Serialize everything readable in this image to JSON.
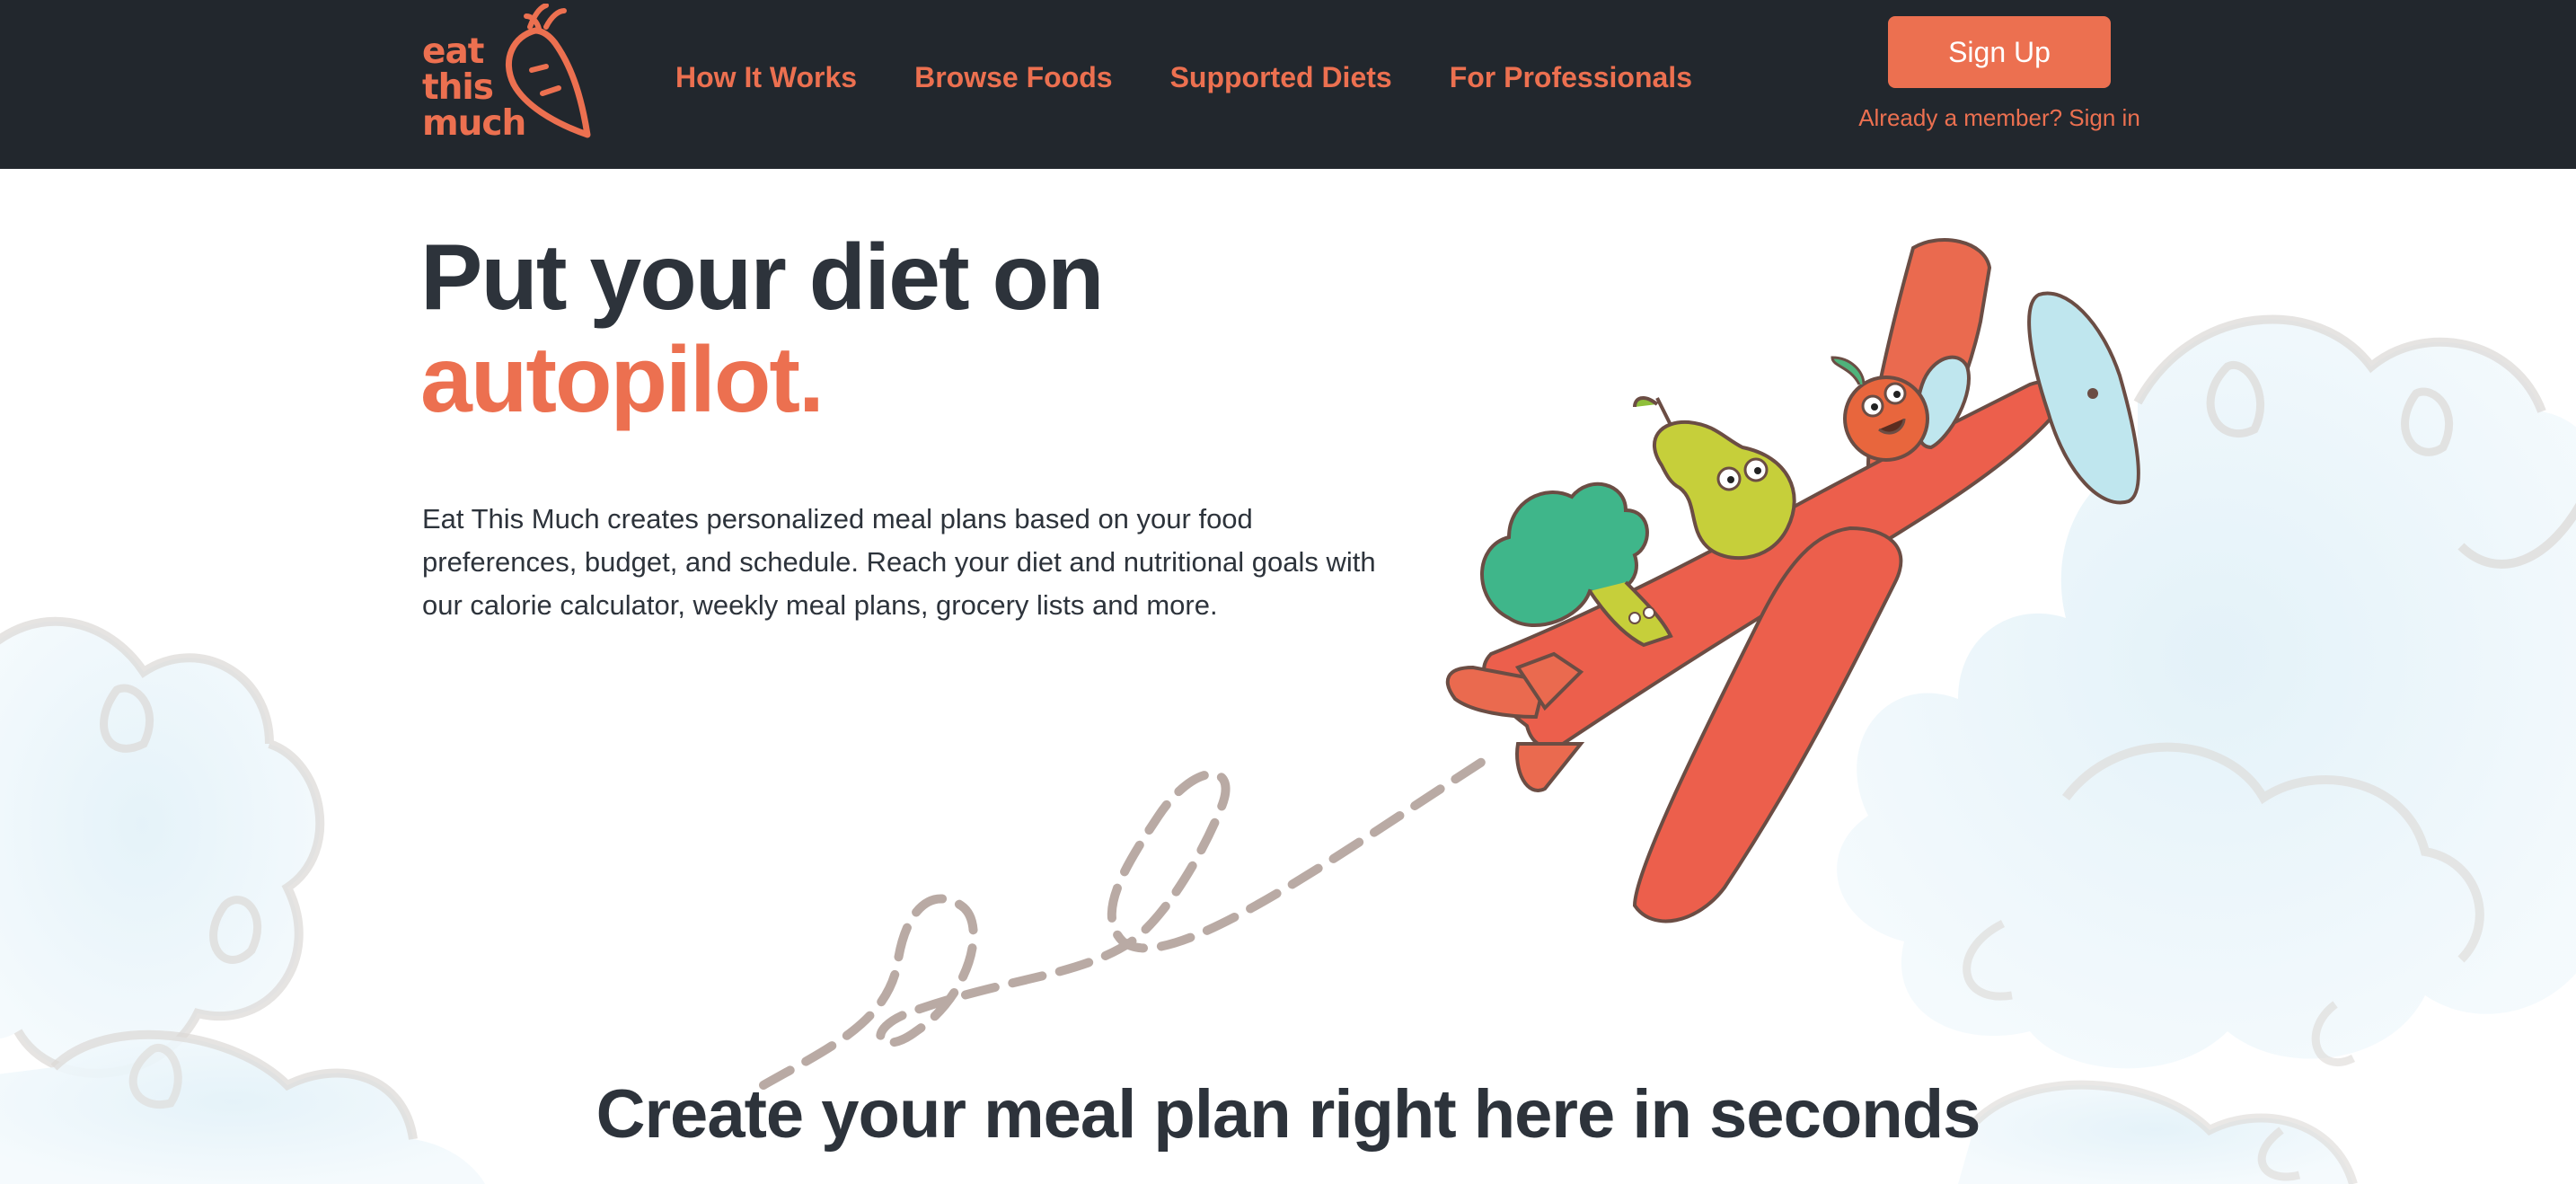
{
  "brand": {
    "logo_lines": [
      "eat",
      "this",
      "much"
    ],
    "color": "#ec7050"
  },
  "nav": {
    "items": [
      "How It Works",
      "Browse Foods",
      "Supported Diets",
      "For Professionals"
    ]
  },
  "auth": {
    "signup_label": "Sign Up",
    "signin_link": "Already a member? Sign in"
  },
  "hero": {
    "title_line1": "Put your diet on",
    "title_accent": "autopilot.",
    "description": "Eat This Much creates personalized meal plans based on your food preferences, budget, and schedule. Reach your diet and nutritional goals with our calorie calculator, weekly meal plans, grocery lists and more.",
    "illustration": "airplane-with-fruit-pilots"
  },
  "section": {
    "title": "Create your meal plan right here in seconds"
  },
  "colors": {
    "header_bg": "#22272d",
    "accent": "#ec7050",
    "text": "#2d333b"
  }
}
